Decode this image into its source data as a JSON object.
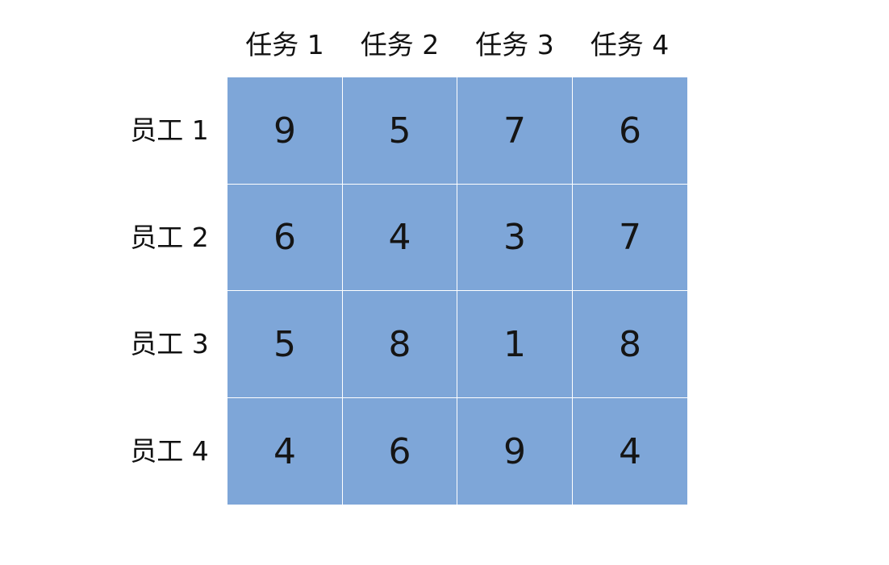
{
  "table": {
    "columns": [
      "任务 1",
      "任务 2",
      "任务 3",
      "任务 4"
    ],
    "rows": [
      "员工 1",
      "员工 2",
      "员工 3",
      "员工 4"
    ],
    "values": [
      [
        9,
        5,
        7,
        6
      ],
      [
        6,
        4,
        3,
        7
      ],
      [
        5,
        8,
        1,
        8
      ],
      [
        4,
        6,
        9,
        4
      ]
    ]
  },
  "colors": {
    "cell_fill": "#7ea6d8",
    "grid_line": "#ffffff",
    "text": "#111111"
  }
}
